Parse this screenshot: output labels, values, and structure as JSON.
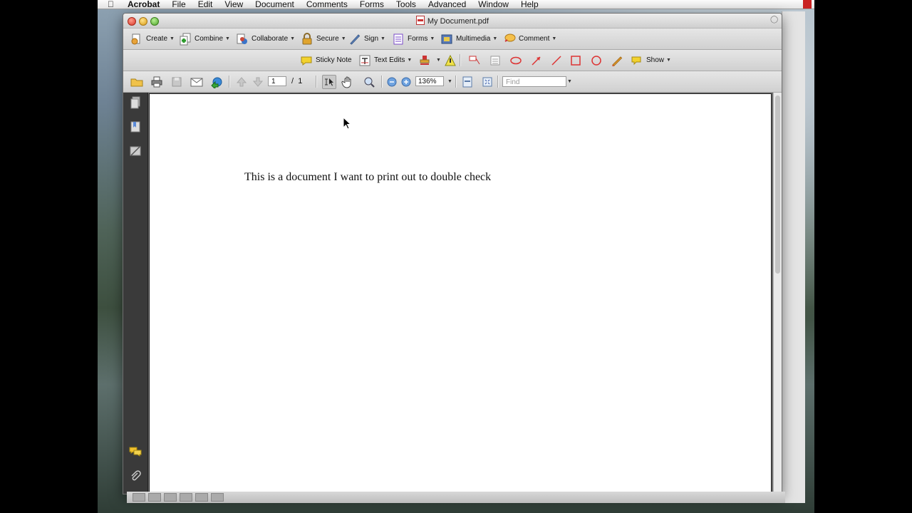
{
  "menubar": {
    "app_name": "Acrobat",
    "items": [
      "File",
      "Edit",
      "View",
      "Document",
      "Comments",
      "Forms",
      "Tools",
      "Advanced",
      "Window",
      "Help"
    ]
  },
  "window": {
    "title": "My Document.pdf"
  },
  "toolbar_tasks": [
    {
      "label": "Create",
      "icon": "create-icon"
    },
    {
      "label": "Combine",
      "icon": "combine-icon"
    },
    {
      "label": "Collaborate",
      "icon": "collaborate-icon"
    },
    {
      "label": "Secure",
      "icon": "lock-icon"
    },
    {
      "label": "Sign",
      "icon": "pen-icon"
    },
    {
      "label": "Forms",
      "icon": "forms-icon"
    },
    {
      "label": "Multimedia",
      "icon": "multimedia-icon"
    },
    {
      "label": "Comment",
      "icon": "comment-icon"
    }
  ],
  "toolbar_comment": {
    "sticky_note": "Sticky Note",
    "text_edits": "Text Edits",
    "show": "Show"
  },
  "toolbar_nav": {
    "current_page": "1",
    "page_sep": "/",
    "total_pages": "1",
    "zoom": "136%",
    "find_placeholder": "Find"
  },
  "document": {
    "text": "This is a document I want to print out to double check"
  },
  "colors": {
    "accent_red": "#cc2222",
    "sticky_yellow": "#f2d22e"
  }
}
